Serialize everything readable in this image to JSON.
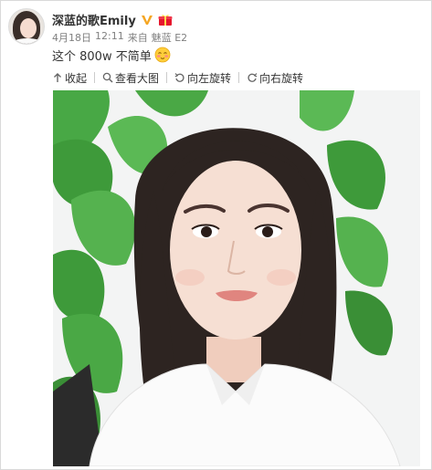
{
  "user": {
    "name": "深蓝的歌Emily"
  },
  "post": {
    "date": "4月18日",
    "time": "12:11",
    "source_prefix": "来自",
    "device": "魅蓝 E2",
    "text": "这个 800w 不简单"
  },
  "toolbar": {
    "collapse_label": "收起",
    "view_large_label": "查看大图",
    "rotate_left_label": "向左旋转",
    "rotate_right_label": "向右旋转"
  },
  "icons": {
    "vip": "verified-v-icon",
    "gift": "red-gift-badge-icon",
    "emoji": "blushing-emoji-icon",
    "collapse": "arrow-up-icon",
    "view_large": "magnifier-icon",
    "rotate_left": "rotate-left-icon",
    "rotate_right": "rotate-right-icon"
  },
  "colors": {
    "username": "#333333",
    "meta": "#808080",
    "vip_badge": "#f5a623",
    "gift_badge": "#e6162d",
    "toolbar_icon": "#666666",
    "border": "#d9d9d9"
  }
}
